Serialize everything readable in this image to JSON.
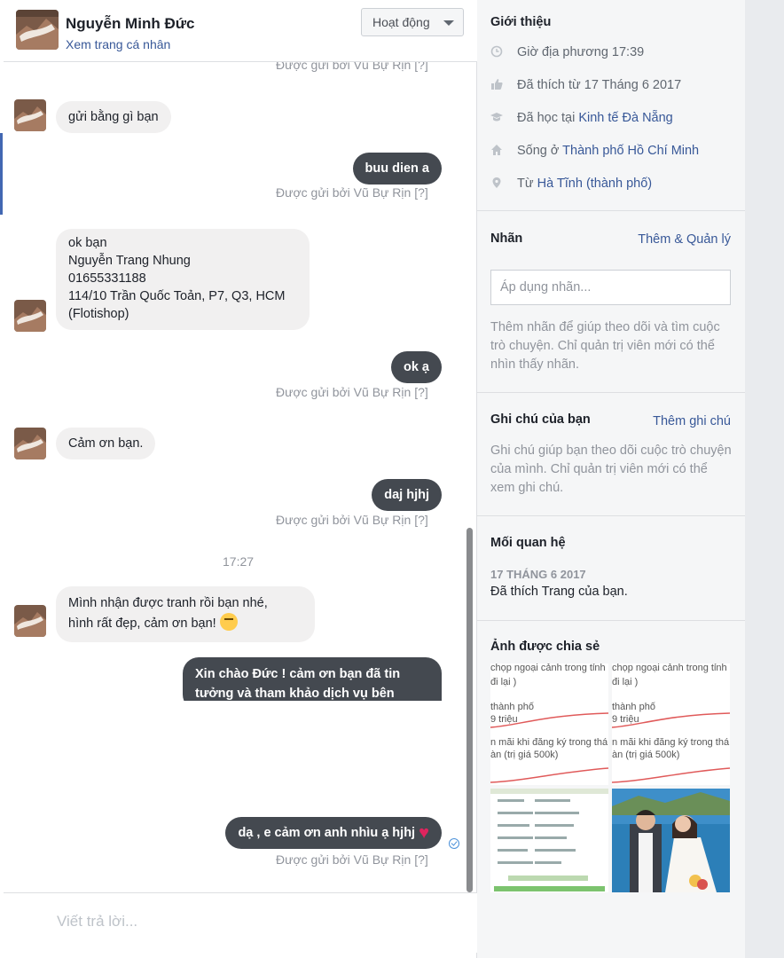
{
  "header": {
    "name": "Nguyễn Minh Đức",
    "profile_link": "Xem trang cá nhân",
    "status": "Hoạt động"
  },
  "messages": {
    "sent_by": "Được gửi bởi Vũ Bự Rịn [?]",
    "items": [
      {
        "from": "them",
        "text": "gửi bằng gì bạn"
      },
      {
        "from": "me",
        "text": "buu dien a"
      },
      {
        "from": "them",
        "lines": [
          "ok bạn",
          "Nguyễn Trang Nhung",
          "01655331188",
          "114/10 Trần Quốc Toản, P7, Q3, HCM",
          "(Flotishop)"
        ]
      },
      {
        "from": "me",
        "text": "ok ạ"
      },
      {
        "from": "them",
        "text": "Cảm ơn bạn."
      },
      {
        "from": "me",
        "text": "daj hjhj"
      },
      {
        "from": "them",
        "lines": [
          "Mình nhận được tranh rồi bạn nhé,",
          "hình rất đẹp, cảm ơn bạn!"
        ]
      },
      {
        "from": "me",
        "lines": [
          "Xin chào Đức !  cảm ơn bạn đã tin",
          "tưởng và tham khảo dịch vụ bên mình,"
        ]
      },
      {
        "from": "me",
        "text": "dạ , e cảm ơn anh nhìu ạ hjhj"
      }
    ],
    "time_separator": "17:27"
  },
  "composer": {
    "placeholder": "Viết trả lời..."
  },
  "info": {
    "intro_title": "Giới thiệu",
    "local_time": "Giờ địa phương 17:39",
    "liked_since": "Đã thích từ 17 Tháng 6 2017",
    "studied_prefix": "Đã học tại ",
    "studied_at": "Kinh tế Đà Nẵng",
    "lives_prefix": "Sống ở ",
    "lives_in": "Thành phố Hồ Chí Minh",
    "from_prefix": "Từ ",
    "from_place": "Hà Tĩnh (thành phố)",
    "labels_title": "Nhãn",
    "labels_action": "Thêm & Quản lý",
    "labels_placeholder": "Áp dụng nhãn...",
    "labels_help": "Thêm nhãn để giúp theo dõi và tìm cuộc trò chuyện. Chỉ quản trị viên mới có thể nhìn thấy nhãn.",
    "notes_title": "Ghi chú của bạn",
    "notes_action": "Thêm ghi chú",
    "notes_help": "Ghi chú giúp bạn theo dõi cuộc trò chuyện của mình. Chỉ quản trị viên mới có thể xem ghi chú.",
    "relation_title": "Mối quan hệ",
    "relation_date": "17 THÁNG 6 2017",
    "relation_text": "Đã thích Trang của bạn.",
    "photos_title": "Ảnh được chia sẻ"
  },
  "colors": {
    "link": "#385898",
    "outgoing_bubble": "#444950",
    "incoming_bubble": "#f1f0f0",
    "like_blue": "#4267b2"
  }
}
